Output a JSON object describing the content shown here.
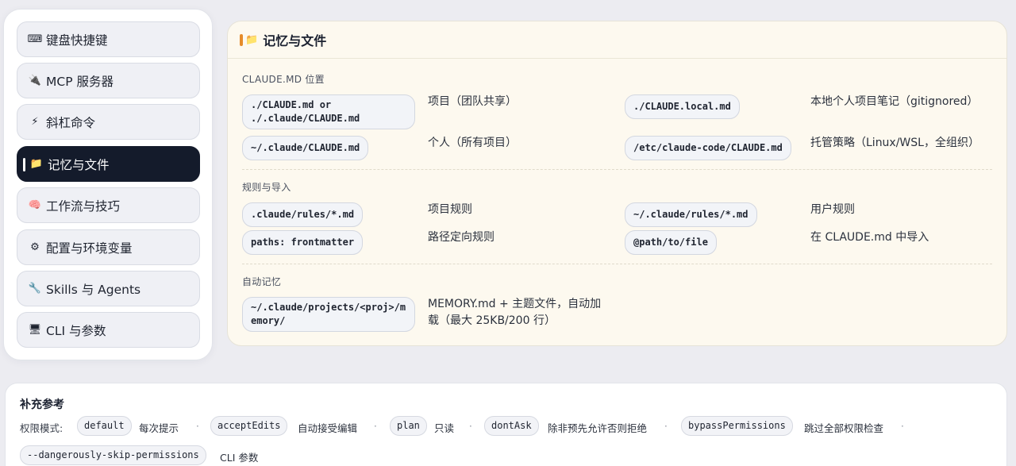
{
  "sidebar": {
    "items": [
      {
        "icon": "keyboard-icon",
        "glyph": "⌨",
        "label": "键盘快捷键",
        "active": false
      },
      {
        "icon": "plug-icon",
        "glyph": "🔌",
        "label": "MCP 服务器",
        "active": false
      },
      {
        "icon": "lightning-icon",
        "glyph": "⚡",
        "label": "斜杠命令",
        "active": false
      },
      {
        "icon": "folder-icon",
        "glyph": "📁",
        "label": "记忆与文件",
        "active": true
      },
      {
        "icon": "brain-icon",
        "glyph": "🧠",
        "label": "工作流与技巧",
        "active": false
      },
      {
        "icon": "gear-icon",
        "glyph": "⚙",
        "label": "配置与环境变量",
        "active": false
      },
      {
        "icon": "wrench-icon",
        "glyph": "🔧",
        "label": "Skills 与 Agents",
        "active": false
      },
      {
        "icon": "monitor-icon",
        "glyph": "🖥",
        "label": "CLI 与参数",
        "active": false
      }
    ]
  },
  "panel": {
    "title": "记忆与文件",
    "title_icon": "📁",
    "sections": {
      "claude_md": {
        "title": "CLAUDE.MD 位置",
        "rows": [
          {
            "code": "./CLAUDE.md or\n./.claude/CLAUDE.md",
            "desc": "项目（团队共享）"
          },
          {
            "code": "./CLAUDE.local.md",
            "desc": "本地个人项目笔记（gitignored）"
          },
          {
            "code": "~/.claude/CLAUDE.md",
            "desc": "个人（所有项目）"
          },
          {
            "code": "/etc/claude-code/CLAUDE.md",
            "desc": "托管策略（Linux/WSL，全组织）"
          }
        ]
      },
      "rules": {
        "title": "规则与导入",
        "rows": [
          {
            "code": ".claude/rules/*.md",
            "desc": "项目规则"
          },
          {
            "code": "~/.claude/rules/*.md",
            "desc": "用户规则"
          },
          {
            "code": "paths: frontmatter",
            "desc": "路径定向规则"
          },
          {
            "code": "@path/to/file",
            "desc": "在 CLAUDE.md 中导入"
          }
        ]
      },
      "auto": {
        "title": "自动记忆",
        "rows": [
          {
            "code": "~/.claude/projects/<proj>/m\nemory/",
            "desc": "MEMORY.md + 主题文件，自动加\n载（最大 25KB/200 行）"
          }
        ]
      }
    }
  },
  "supplement": {
    "title": "补充参考",
    "modes_label": "权限模式:",
    "modes": [
      {
        "code": "default",
        "desc": "每次提示"
      },
      {
        "code": "acceptEdits",
        "desc": "自动接受编辑"
      },
      {
        "code": "plan",
        "desc": "只读"
      },
      {
        "code": "dontAsk",
        "desc": "除非预先允许否则拒绝"
      },
      {
        "code": "bypassPermissions",
        "desc": "跳过全部权限检查"
      }
    ],
    "flag": {
      "code": "--dangerously-skip-permissions",
      "desc": "CLI 参数"
    }
  },
  "colors": {
    "active_bg": "#141b2b",
    "panel_bg": "#fdf9ef",
    "accent": "#e58b2a"
  }
}
